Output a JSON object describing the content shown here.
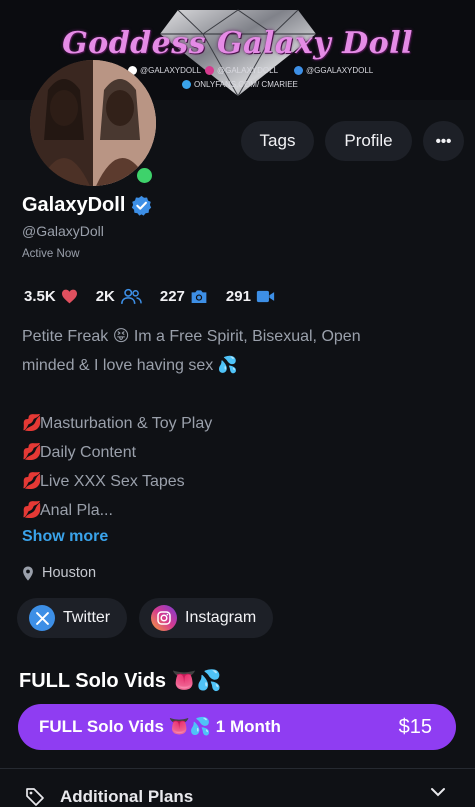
{
  "banner": {
    "title": "Goddess Galaxy Doll",
    "handles": [
      "@GALAXYDOLL",
      "@GALAXYDOLL",
      "@GGALAXYDOLL"
    ],
    "onlyfans": "ONLYFANS.COM/ CMARIEE"
  },
  "header_buttons": {
    "tags": "Tags",
    "profile": "Profile",
    "more": "•••"
  },
  "profile": {
    "name": "GalaxyDoll",
    "username": "@GalaxyDoll",
    "status": "Active Now",
    "online": true
  },
  "stats": {
    "likes": "3.5K",
    "fans": "2K",
    "photos": "227",
    "videos": "291"
  },
  "bio": {
    "line1": "Petite Freak 😝 Im a Free Spirit, Bisexual, Open",
    "line2": "minded & I love having sex 💦",
    "items": [
      "Masturbation & Toy Play",
      "Daily Content",
      "Live XXX Sex Tapes",
      "Anal Pla..."
    ],
    "show_more": "Show more"
  },
  "location": "Houston",
  "socials": {
    "twitter": "Twitter",
    "instagram": "Instagram"
  },
  "subscription": {
    "section_title": "FULL Solo Vids 👅💦",
    "plan_label": "FULL Solo Vids 👅💦 1 Month",
    "price": "$15"
  },
  "additional_plans": "Additional Plans",
  "colors": {
    "background": "#0f1115",
    "accent": "#8f3df2",
    "link": "#3aa3ea",
    "online": "#3ed26b",
    "heart": "#e0505f",
    "icon_blue": "#3d8fe6"
  }
}
